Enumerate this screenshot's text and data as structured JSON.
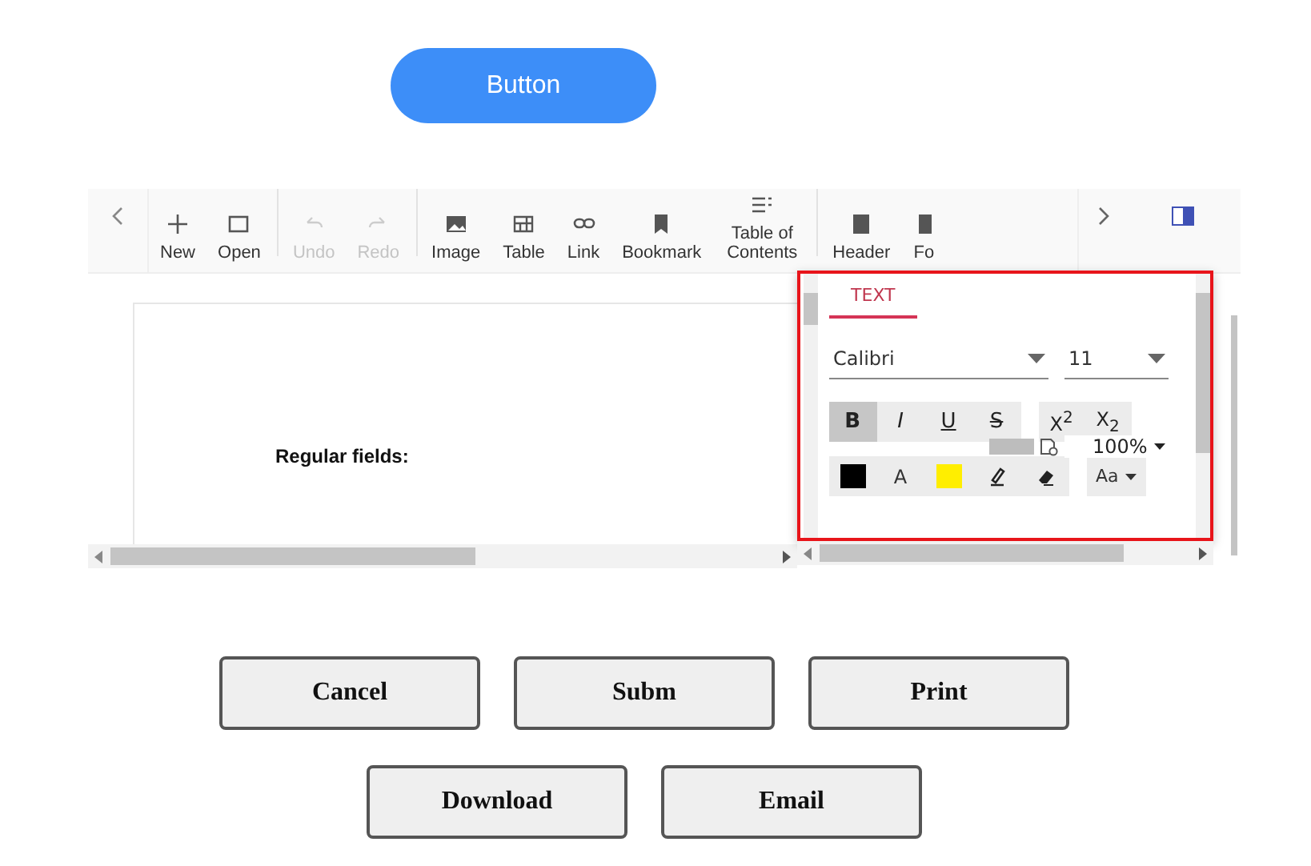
{
  "top_button": {
    "label": "Button"
  },
  "toolbar": {
    "items": [
      {
        "label": "New",
        "disabled": false,
        "separator_after": false
      },
      {
        "label": "Open",
        "disabled": false,
        "separator_after": true
      },
      {
        "label": "Undo",
        "disabled": true,
        "separator_after": false
      },
      {
        "label": "Redo",
        "disabled": true,
        "separator_after": true
      },
      {
        "label": "Image",
        "disabled": false,
        "separator_after": false
      },
      {
        "label": "Table",
        "disabled": false,
        "separator_after": false
      },
      {
        "label": "Link",
        "disabled": false,
        "separator_after": false
      },
      {
        "label": "Bookmark",
        "disabled": false,
        "separator_after": false
      },
      {
        "label": "Table of Contents",
        "disabled": false,
        "separator_after": true
      },
      {
        "label": "Header",
        "disabled": false,
        "separator_after": false
      },
      {
        "label": "Fo",
        "disabled": false,
        "separator_after": false
      }
    ]
  },
  "document": {
    "heading": "Regular fields:"
  },
  "properties_pane": {
    "tabs": [
      {
        "label": "TEXT",
        "selected": true
      }
    ],
    "font_family": {
      "value": "Calibri"
    },
    "font_size": {
      "value": "11"
    },
    "format_buttons": [
      {
        "label": "B",
        "selected": true
      },
      {
        "label": "I",
        "selected": false
      },
      {
        "label": "U",
        "selected": false
      },
      {
        "label": "S",
        "selected": false
      }
    ],
    "script_buttons": [
      {
        "label": "X$^{2}$",
        "selected": false
      },
      {
        "label": "X$_{2}$",
        "selected": false
      }
    ],
    "font_color": {
      "color": "#000000"
    },
    "highlight_color": {
      "color": "#ffee00"
    },
    "font_color_label": "A",
    "case_dropdown": {
      "label": "Aa"
    },
    "zoom": {
      "value": "100%"
    }
  },
  "action_buttons": [
    [
      {
        "label": "Cancel"
      },
      {
        "label": "Subm"
      },
      {
        "label": "Print"
      }
    ],
    [
      {
        "label": "Download"
      },
      {
        "label": "Email"
      }
    ]
  ]
}
